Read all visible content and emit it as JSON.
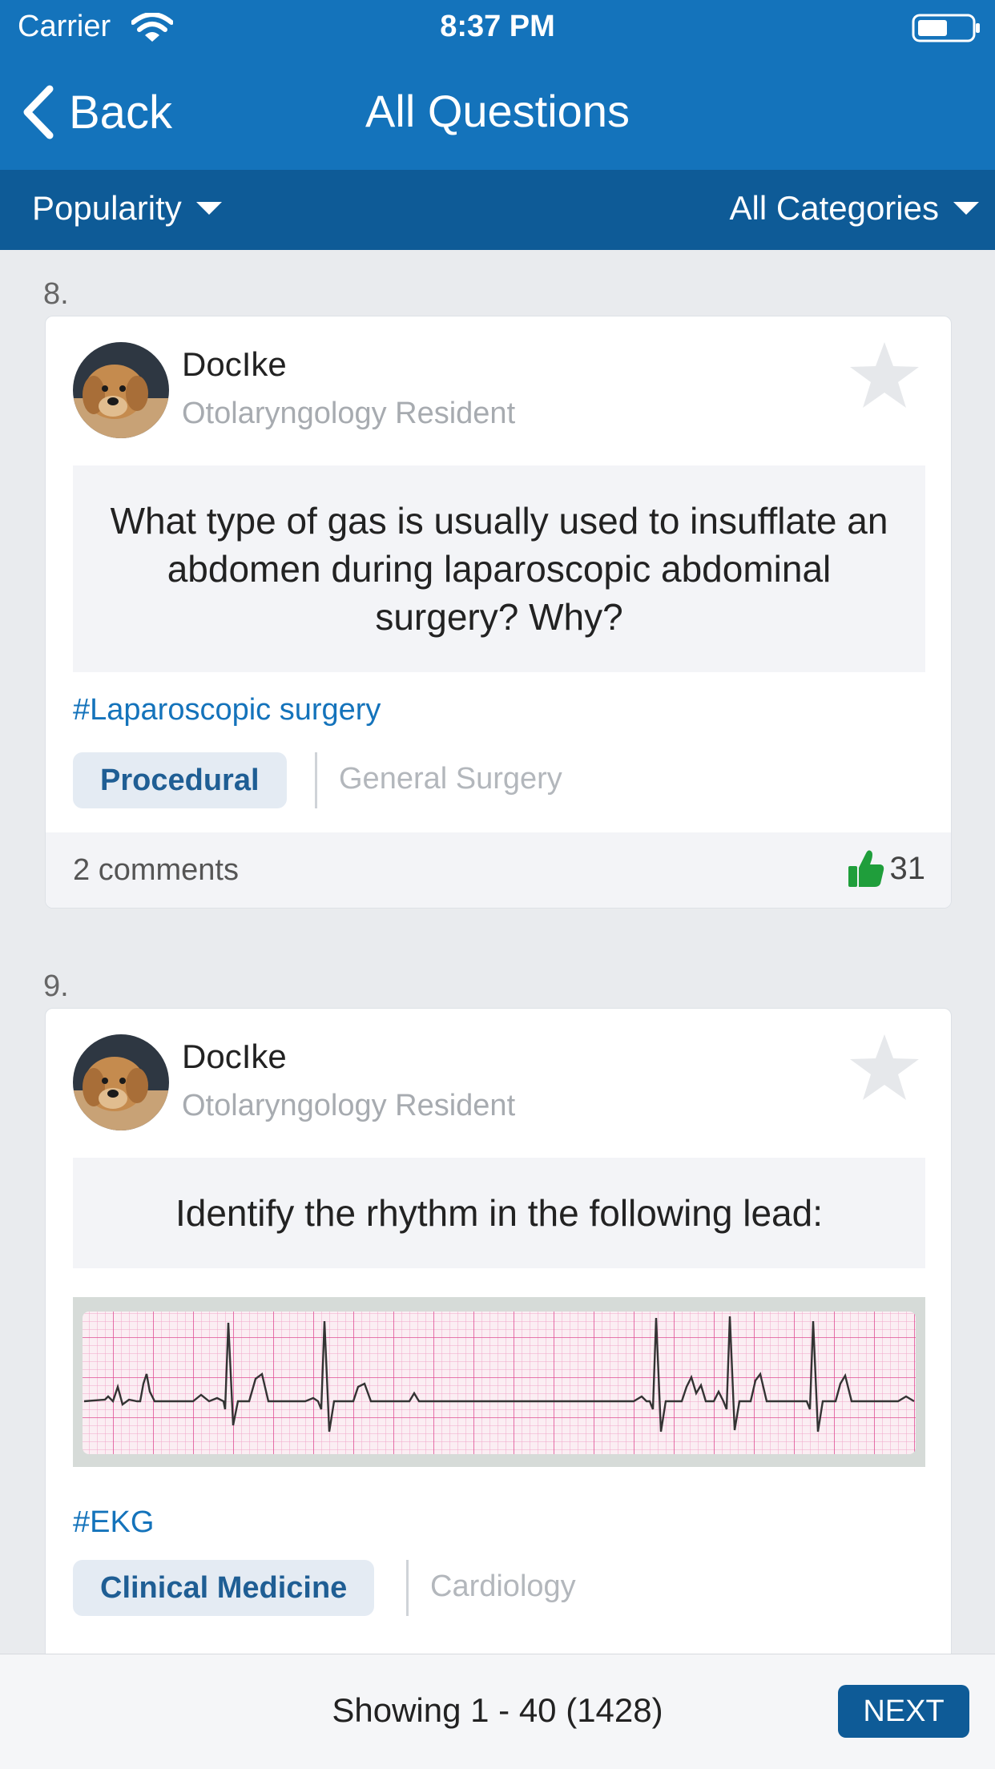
{
  "status": {
    "carrier": "Carrier",
    "time": "8:37 PM"
  },
  "nav": {
    "back_label": "Back",
    "title": "All Questions"
  },
  "filters": {
    "sort_label": "Popularity",
    "category_label": "All Categories"
  },
  "questions": [
    {
      "number": "8.",
      "author": "DocIke",
      "role": "Otolaryngology Resident",
      "question": "What type of gas is usually used to insufflate an abdomen during laparoscopic abdominal surgery? Why?",
      "hashtag": "#Laparoscopic surgery",
      "category": "Procedural",
      "subcategory": "General Surgery",
      "comments": "2 comments",
      "likes": "31"
    },
    {
      "number": "9.",
      "author": "DocIke",
      "role": "Otolaryngology Resident",
      "question": "Identify the rhythm in the following lead:",
      "hashtag": "#EKG",
      "category": "Clinical Medicine",
      "subcategory": "Cardiology"
    }
  ],
  "pagination": {
    "showing": "Showing 1 - 40 (1428)",
    "next_label": "NEXT"
  },
  "colors": {
    "primary": "#1473bb",
    "primary_dark": "#0e5b97",
    "like_green": "#1f9e3b"
  }
}
